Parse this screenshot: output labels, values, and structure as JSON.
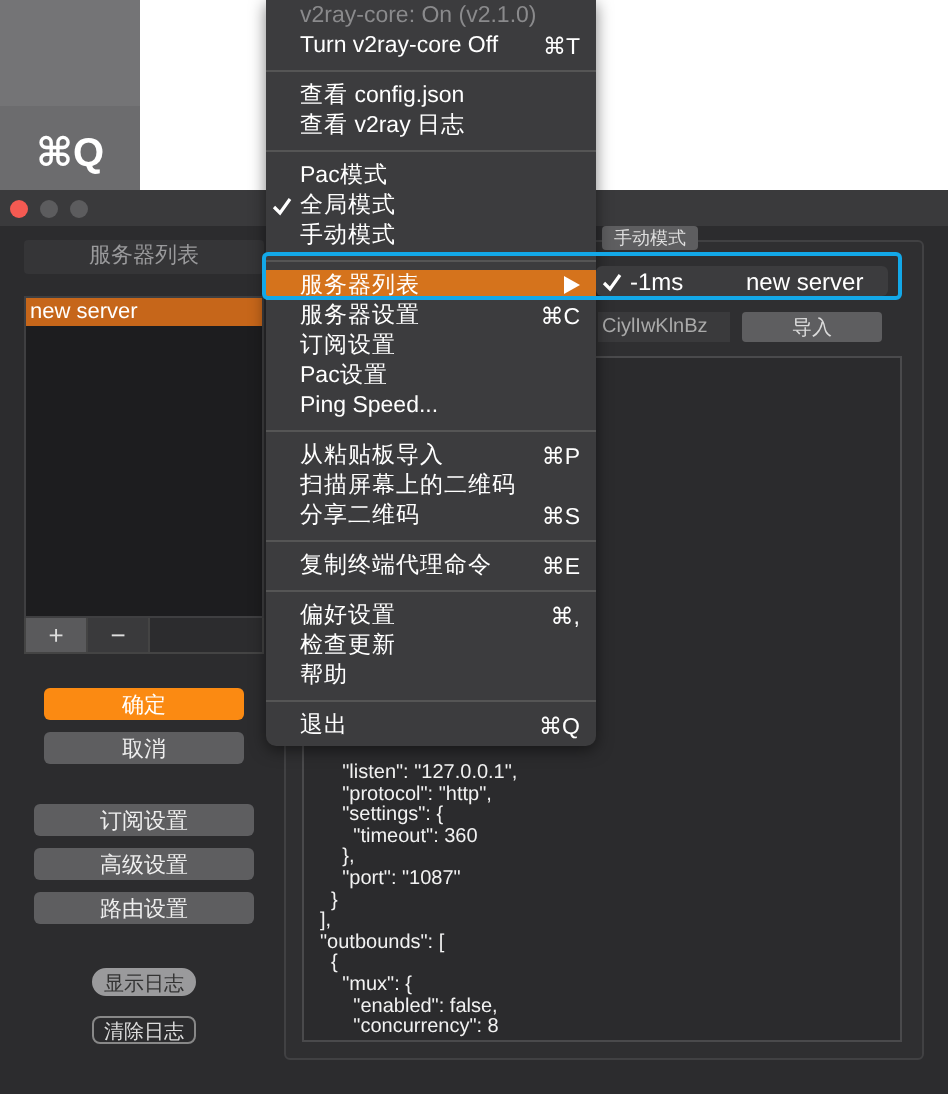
{
  "background_menu": {
    "shortcut": "⌘Q"
  },
  "server_list": {
    "title": "服务器列表",
    "servers": [
      {
        "name": "new server",
        "selected": true
      }
    ],
    "buttons": [
      "+",
      "−"
    ]
  },
  "dialog_buttons": [
    {
      "label": "确定",
      "kind": "primary"
    },
    {
      "label": "取消",
      "kind": "normal"
    }
  ],
  "settings_buttons": [
    "订阅设置",
    "高级设置",
    "路由设置"
  ],
  "log_buttons": [
    {
      "label": "显示日志",
      "selected": true
    },
    {
      "label": "清除日志",
      "selected": false
    }
  ],
  "mode_button": "手动模式",
  "import": {
    "value": "CiylIwKlnBz",
    "button": "导入"
  },
  "config_lines": [
    "    \"listen\": \"127.0.0.1\",",
    "    \"protocol\": \"http\",",
    "    \"settings\": {",
    "      \"timeout\": 360",
    "    },",
    "    \"port\": \"1087\"",
    "  }",
    "],",
    "\"outbounds\": [",
    "  {",
    "    \"mux\": {",
    "      \"enabled\": false,",
    "      \"concurrency\": 8"
  ],
  "menu": {
    "sections": [
      [
        {
          "label": "v2ray-core: On  (v2.1.0)",
          "kind": "action",
          "disabled": true,
          "checked": false,
          "selected": false
        },
        {
          "label": "Turn v2ray-core Off",
          "shortcut": "⌘T",
          "kind": "action",
          "disabled": false,
          "checked": false,
          "selected": false
        }
      ],
      [
        {
          "label": "查看 config.json",
          "kind": "action",
          "disabled": false,
          "checked": false,
          "selected": false
        },
        {
          "label": "查看 v2ray 日志",
          "kind": "action",
          "disabled": false,
          "checked": false,
          "selected": false
        }
      ],
      [
        {
          "label": "Pac模式",
          "kind": "action",
          "disabled": false,
          "checked": false,
          "selected": false
        },
        {
          "label": "全局模式",
          "kind": "action",
          "disabled": false,
          "checked": true,
          "selected": false
        },
        {
          "label": "手动模式",
          "kind": "action",
          "disabled": false,
          "checked": false,
          "selected": false
        }
      ],
      [
        {
          "label": "服务器列表",
          "kind": "submenu",
          "disabled": false,
          "checked": false,
          "selected": true
        },
        {
          "label": "服务器设置",
          "shortcut": "⌘C",
          "kind": "action",
          "disabled": false,
          "checked": false,
          "selected": false
        },
        {
          "label": "订阅设置",
          "kind": "action",
          "disabled": false,
          "checked": false,
          "selected": false
        },
        {
          "label": "Pac设置",
          "kind": "action",
          "disabled": false,
          "checked": false,
          "selected": false
        },
        {
          "label": "Ping Speed...",
          "kind": "action",
          "disabled": false,
          "checked": false,
          "selected": false
        }
      ],
      [
        {
          "label": "从粘贴板导入",
          "shortcut": "⌘P",
          "kind": "action",
          "disabled": false,
          "checked": false,
          "selected": false
        },
        {
          "label": "扫描屏幕上的二维码",
          "kind": "action",
          "disabled": false,
          "checked": false,
          "selected": false
        },
        {
          "label": "分享二维码",
          "shortcut": "⌘S",
          "kind": "action",
          "disabled": false,
          "checked": false,
          "selected": false
        }
      ],
      [
        {
          "label": "复制终端代理命令",
          "shortcut": "⌘E",
          "kind": "action",
          "disabled": false,
          "checked": false,
          "selected": false
        }
      ],
      [
        {
          "label": "偏好设置",
          "shortcut": "⌘,",
          "kind": "action",
          "disabled": false,
          "checked": false,
          "selected": false
        },
        {
          "label": "检查更新",
          "kind": "action",
          "disabled": false,
          "checked": false,
          "selected": false
        },
        {
          "label": "帮助",
          "kind": "action",
          "disabled": false,
          "checked": false,
          "selected": false
        }
      ],
      [
        {
          "label": "退出",
          "shortcut": "⌘Q",
          "kind": "action",
          "disabled": false,
          "checked": false,
          "selected": false
        }
      ]
    ]
  },
  "submenu": {
    "items": [
      {
        "ping": "-1ms",
        "name": "new server",
        "checked": true
      }
    ]
  }
}
